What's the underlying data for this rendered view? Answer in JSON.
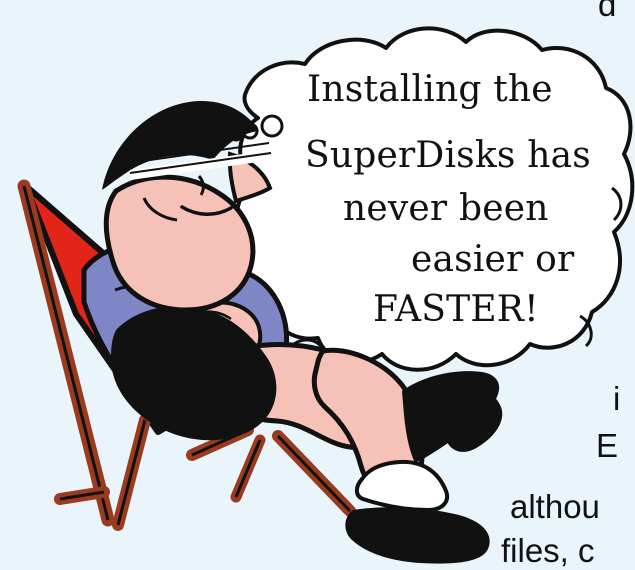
{
  "thought_bubble": {
    "line1": "Installing the",
    "line2": "SuperDisks has",
    "line3": "never been",
    "line4": "easier or",
    "line5": "FASTER!"
  },
  "background_text": {
    "top_fragment": "d",
    "right_fragment_1": "i",
    "right_fragment_2": "E",
    "right_fragment_3": "althou",
    "right_fragment_4": "files, c"
  },
  "colors": {
    "background": "#e9f4fb",
    "chair_red": "#e12519",
    "chair_wood": "#9a3b20",
    "shirt_blue": "#7f86c6",
    "skin": "#f6c2b7",
    "shorts_black": "#111111"
  },
  "illustration": {
    "subject": "man-relaxing-in-deck-chair"
  }
}
